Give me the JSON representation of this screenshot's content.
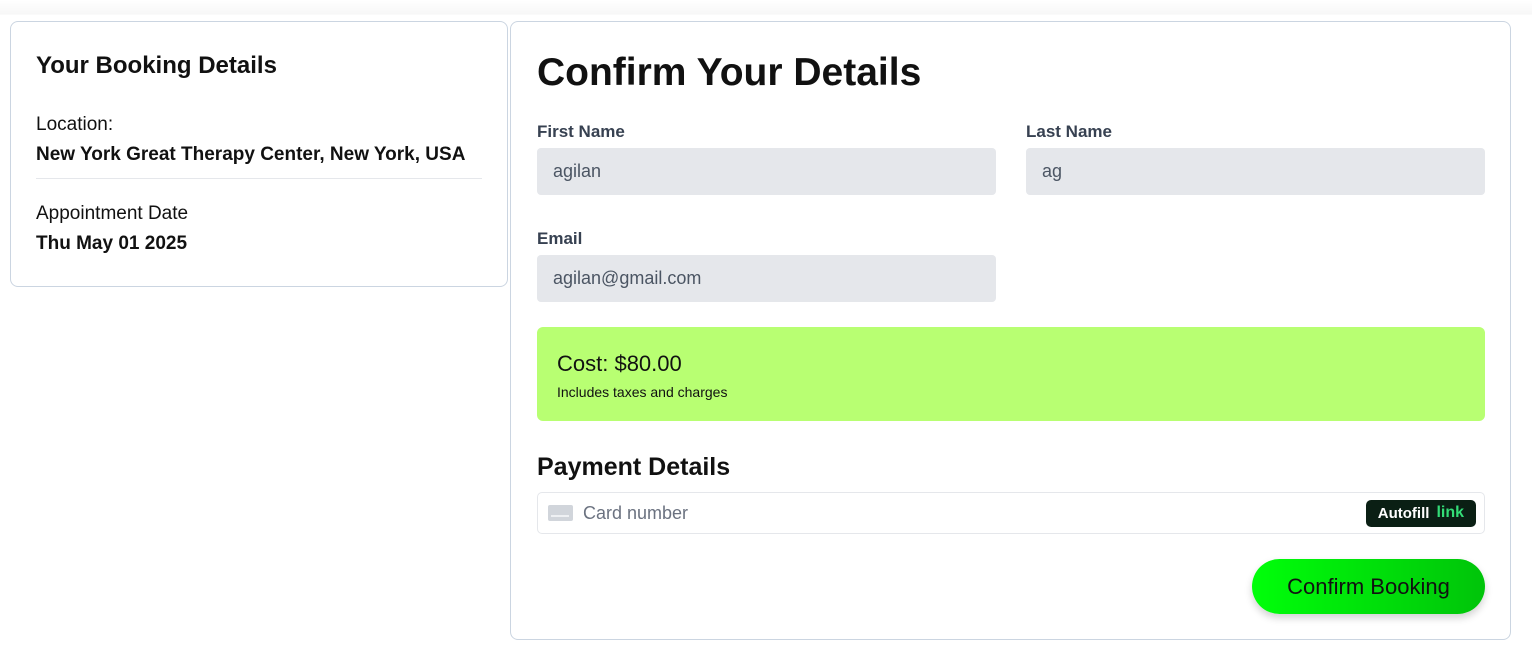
{
  "booking": {
    "title": "Your Booking Details",
    "location_label": "Location:",
    "location_value": "New York Great Therapy Center, New York, USA",
    "date_label": "Appointment Date",
    "date_value": "Thu May 01 2025"
  },
  "form": {
    "title": "Confirm Your Details",
    "first_name_label": "First Name",
    "first_name_value": "agilan",
    "last_name_label": "Last Name",
    "last_name_value": "ag",
    "email_label": "Email",
    "email_value": "agilan@gmail.com"
  },
  "cost": {
    "amount": "Cost: $80.00",
    "note": "Includes taxes and charges",
    "color": "#b8ff72"
  },
  "payment": {
    "title": "Payment Details",
    "card_placeholder": "Card number",
    "card_icon": "credit-card-icon",
    "autofill_label": "Autofill",
    "autofill_brand": "link"
  },
  "actions": {
    "confirm_label": "Confirm Booking",
    "accent": "#00e60a"
  }
}
